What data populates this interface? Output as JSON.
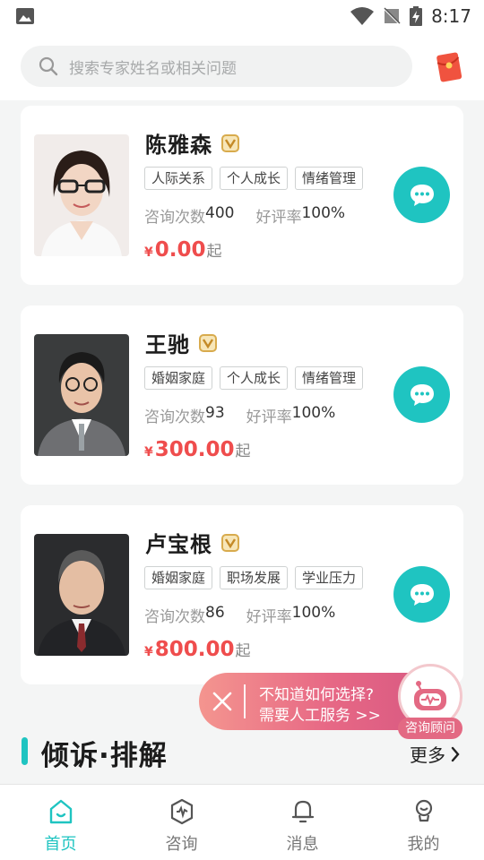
{
  "status_bar": {
    "time": "8:17"
  },
  "search": {
    "placeholder": "搜索专家姓名或相关问题"
  },
  "experts": [
    {
      "name": "陈雅森",
      "tags": [
        "人际关系",
        "个人成长",
        "情绪管理"
      ],
      "consult_label": "咨询次数",
      "consult_count": "400",
      "rating_label": "好评率",
      "rating": "100%",
      "currency": "¥",
      "price": "0.00",
      "price_suffix": "起"
    },
    {
      "name": "王驰",
      "tags": [
        "婚姻家庭",
        "个人成长",
        "情绪管理"
      ],
      "consult_label": "咨询次数",
      "consult_count": "93",
      "rating_label": "好评率",
      "rating": "100%",
      "currency": "¥",
      "price": "300.00",
      "price_suffix": "起"
    },
    {
      "name": "卢宝根",
      "tags": [
        "婚姻家庭",
        "职场发展",
        "学业压力"
      ],
      "consult_label": "咨询次数",
      "consult_count": "86",
      "rating_label": "好评率",
      "rating": "100%",
      "currency": "¥",
      "price": "800.00",
      "price_suffix": "起"
    }
  ],
  "banner": {
    "line1": "不知道如何选择?",
    "line2": "需要人工服务 >>",
    "advisor_label": "咨询顾问"
  },
  "section": {
    "title": "倾诉·排解",
    "more": "更多"
  },
  "tabs": [
    {
      "label": "首页",
      "icon": "home-icon",
      "active": true
    },
    {
      "label": "咨询",
      "icon": "consult-icon",
      "active": false
    },
    {
      "label": "消息",
      "icon": "bell-icon",
      "active": false
    },
    {
      "label": "我的",
      "icon": "profile-icon",
      "active": false
    }
  ],
  "colors": {
    "accent": "#1fc4c1",
    "price": "#ef4d4d",
    "banner": "#e76885"
  }
}
